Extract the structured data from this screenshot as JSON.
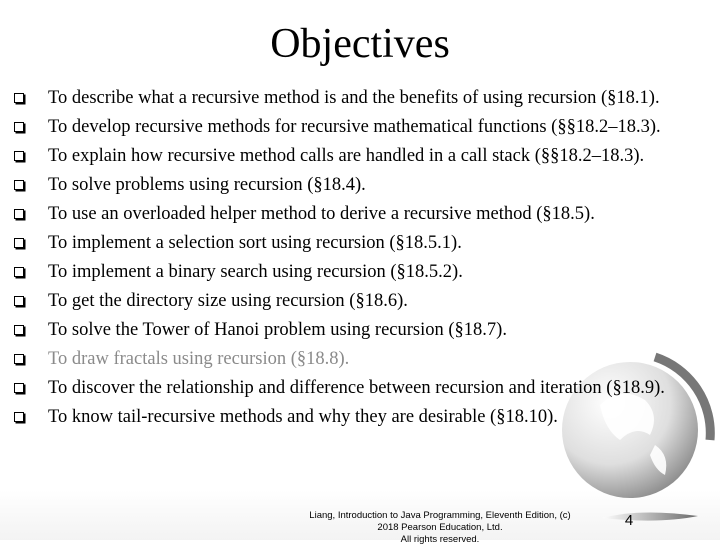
{
  "slide": {
    "title": "Objectives",
    "objectives": [
      {
        "text": "To describe what a recursive method is and the benefits of using recursion (§18.1)."
      },
      {
        "text": "To develop recursive methods for recursive mathematical functions (§§18.2–18.3)."
      },
      {
        "text": "To explain how recursive method calls are handled in a call stack (§§18.2–18.3)."
      },
      {
        "text": "To solve problems using recursion (§18.4)."
      },
      {
        "text": "To use an overloaded helper method to derive a recursive method (§18.5)."
      },
      {
        "text": "To implement a selection sort using recursion (§18.5.1)."
      },
      {
        "text": "To implement a binary search using recursion (§18.5.2)."
      },
      {
        "text": "To get the directory size using recursion (§18.6)."
      },
      {
        "text": "To solve the Tower of Hanoi problem using recursion (§18.7)."
      },
      {
        "text": "To draw fractals using recursion (§18.8)."
      },
      {
        "text": "To discover the relationship and difference between recursion and iteration (§18.9)."
      },
      {
        "text": "To know tail-recursive methods and why they are desirable (§18.10)."
      }
    ],
    "footer_line1": "Liang, Introduction to Java Programming, Eleventh Edition, (c) 2018 Pearson Education, Ltd.",
    "footer_line2": "All rights reserved.",
    "page_number": "4",
    "dim_color": "#8a8a8a"
  }
}
